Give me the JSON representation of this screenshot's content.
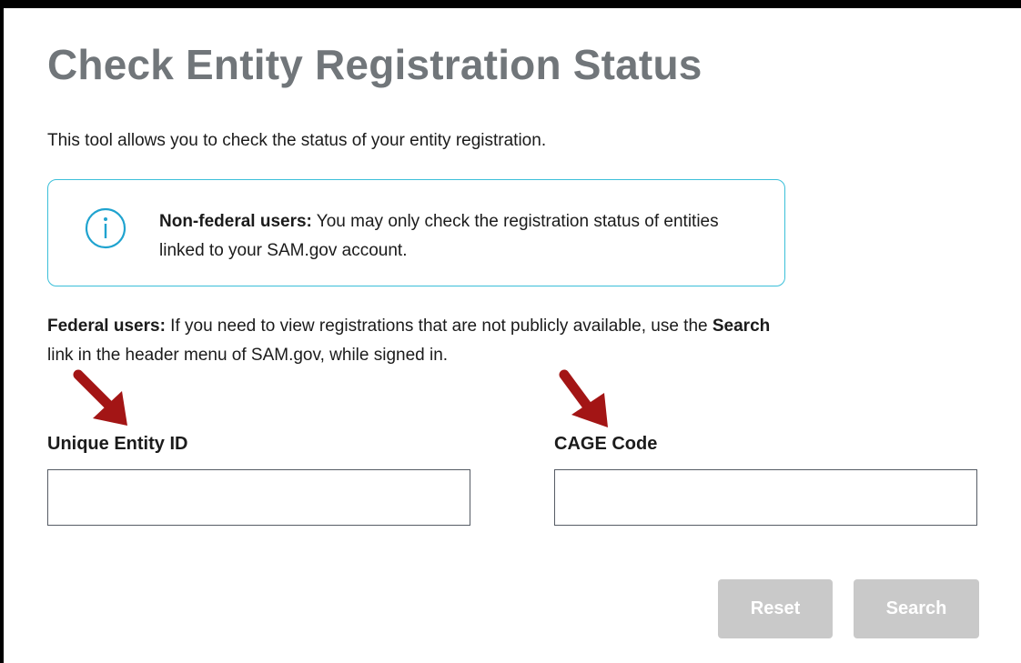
{
  "page": {
    "title": "Check Entity Registration Status",
    "intro": "This tool allows you to check the status of your entity registration."
  },
  "alert": {
    "icon": "info-icon",
    "bold_text": "Non-federal users:",
    "text": " You may only check the registration status of entities linked to your SAM.gov account."
  },
  "federal_note": {
    "bold_lead": "Federal users:",
    "text_1": " If you need to view registrations that are not publicly available, use the ",
    "bold_link": "Search",
    "text_2": " link in the header menu of SAM.gov, while signed in."
  },
  "fields": {
    "uei_label": "Unique Entity ID",
    "uei_value": "",
    "cage_label": "CAGE Code",
    "cage_value": ""
  },
  "buttons": {
    "reset": "Reset",
    "search": "Search"
  },
  "colors": {
    "title": "#71767a",
    "alert_border": "#3bbfd9",
    "button_disabled": "#c9c9c9",
    "annotation_arrow": "#a31515"
  }
}
